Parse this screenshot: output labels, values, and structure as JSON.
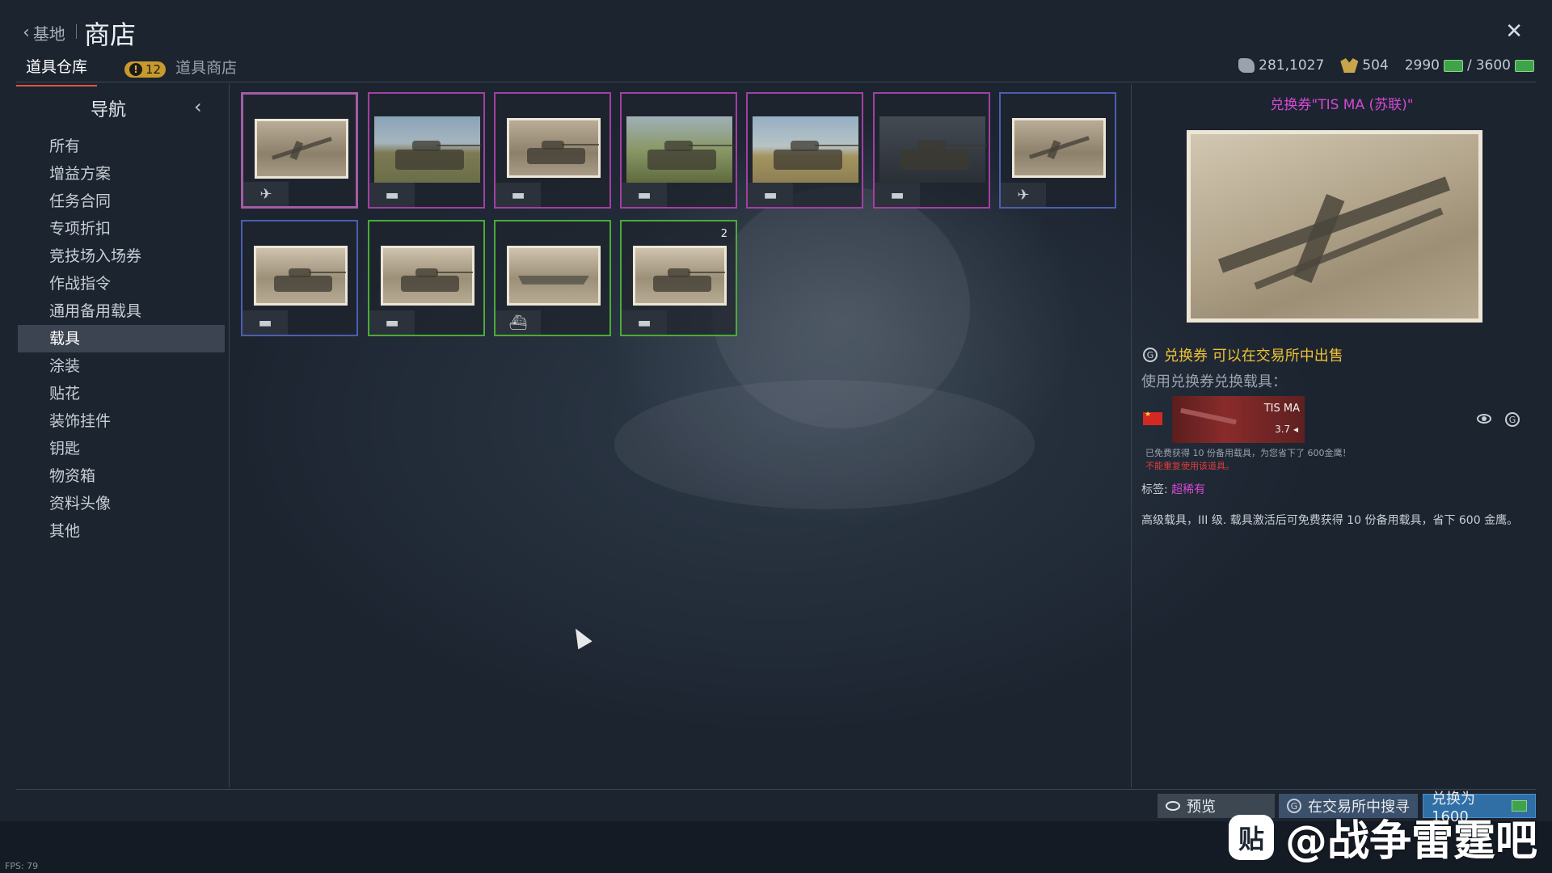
{
  "header": {
    "back_label": "基地",
    "title": "商店",
    "tabs": [
      {
        "label": "道具仓库",
        "active": true
      },
      {
        "label": "道具商店",
        "active": false,
        "badge": "12"
      }
    ]
  },
  "currencies": {
    "silver_lions": "281,1027",
    "rp": "504",
    "gold": "2990",
    "gold_max": "3600"
  },
  "nav": {
    "title": "导航",
    "items": [
      {
        "label": "所有"
      },
      {
        "label": "增益方案"
      },
      {
        "label": "任务合同"
      },
      {
        "label": "专项折扣"
      },
      {
        "label": "竞技场入场券"
      },
      {
        "label": "作战指令"
      },
      {
        "label": "通用备用载具"
      },
      {
        "label": "载具",
        "active": true
      },
      {
        "label": "涂装"
      },
      {
        "label": "贴花"
      },
      {
        "label": "装饰挂件"
      },
      {
        "label": "钥匙"
      },
      {
        "label": "物资箱"
      },
      {
        "label": "资料头像"
      },
      {
        "label": "其他"
      }
    ]
  },
  "grid": {
    "items": [
      {
        "type": "plane",
        "border": "#a35ca3",
        "pic": "sepia",
        "selected": true
      },
      {
        "type": "tank",
        "border": "#a33fa3",
        "pic": "field"
      },
      {
        "type": "tank",
        "border": "#a33fa3",
        "pic": "sepia"
      },
      {
        "type": "tank",
        "border": "#a33fa3",
        "pic": "green"
      },
      {
        "type": "tank",
        "border": "#a33fa3",
        "pic": "sand"
      },
      {
        "type": "tank",
        "border": "#a33fa3",
        "pic": "dark"
      },
      {
        "type": "plane",
        "border": "#4a5fb0",
        "pic": "sepia"
      },
      {
        "type": "tank",
        "border": "#4a5fb0",
        "pic": "sepia2"
      },
      {
        "type": "tank",
        "border": "#4caa3a",
        "pic": "sepia2"
      },
      {
        "type": "ship",
        "border": "#4caa3a",
        "pic": "sepia2"
      },
      {
        "type": "tank",
        "border": "#4caa3a",
        "pic": "sepia2",
        "count": "2"
      }
    ]
  },
  "detail": {
    "title": "兑换券\"TIS MA (苏联)\"",
    "sell_text": "兑换券 可以在交易所中出售",
    "use_text": "使用兑换券兑换载具：",
    "vehicle": {
      "name": "TIS MA",
      "br": "3.7"
    },
    "note1": "已免费获得 10 份备用载具，为您省下了 600金鹰！",
    "note2": "不能重复使用该道具。",
    "tag_label": "标签:",
    "tag_value": "超稀有",
    "description": "高级载具，III 级. 载具激活后可免费获得 10 份备用载具，省下 600 金鹰。"
  },
  "buttons": {
    "preview": "预览",
    "search_market": "在交易所中搜寻",
    "exchange": "兑换为 1600"
  },
  "fps": "FPS: 79",
  "watermark": {
    "logo": "贴",
    "text": "@战争雷霆吧"
  },
  "colors": {
    "accent": "#e0563a",
    "epic": "#d449d4",
    "gold_text": "#f0c234",
    "warning": "#e23b3b"
  }
}
